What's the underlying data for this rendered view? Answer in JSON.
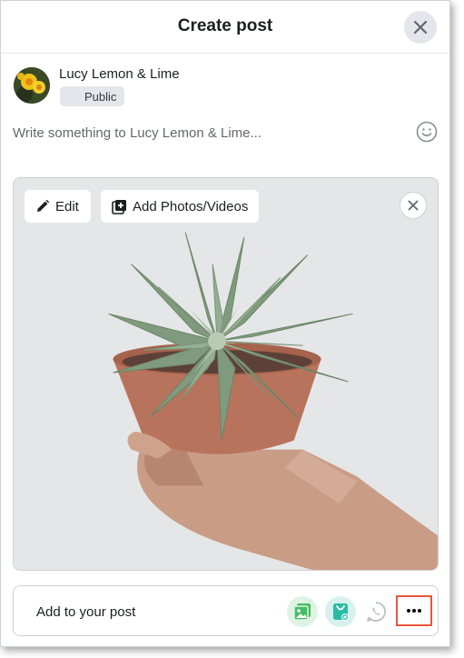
{
  "dialog": {
    "title": "Create post",
    "close_icon": "close-icon"
  },
  "user": {
    "name": "Lucy Lemon & Lime",
    "privacy_label": "Public",
    "avatar_icon": "yellow-flower-avatar"
  },
  "composer": {
    "placeholder": "Write something to Lucy Lemon & Lime...",
    "emoji_icon": "smiley-icon"
  },
  "media": {
    "edit_label": "Edit",
    "add_photos_label": "Add Photos/Videos",
    "remove_icon": "close-icon",
    "photo_subject": "succulent-in-terracotta-pot"
  },
  "add_to_post": {
    "label": "Add to your post",
    "tools": [
      {
        "icon": "photo-video-icon",
        "color": "#45bd62"
      },
      {
        "icon": "shop-bag-icon",
        "color": "#2abba7"
      },
      {
        "icon": "whatsapp-icon",
        "color": "#bcc0c4"
      },
      {
        "icon": "more-icon",
        "color": "#050505"
      }
    ],
    "highlight_color": "#e8553a"
  }
}
